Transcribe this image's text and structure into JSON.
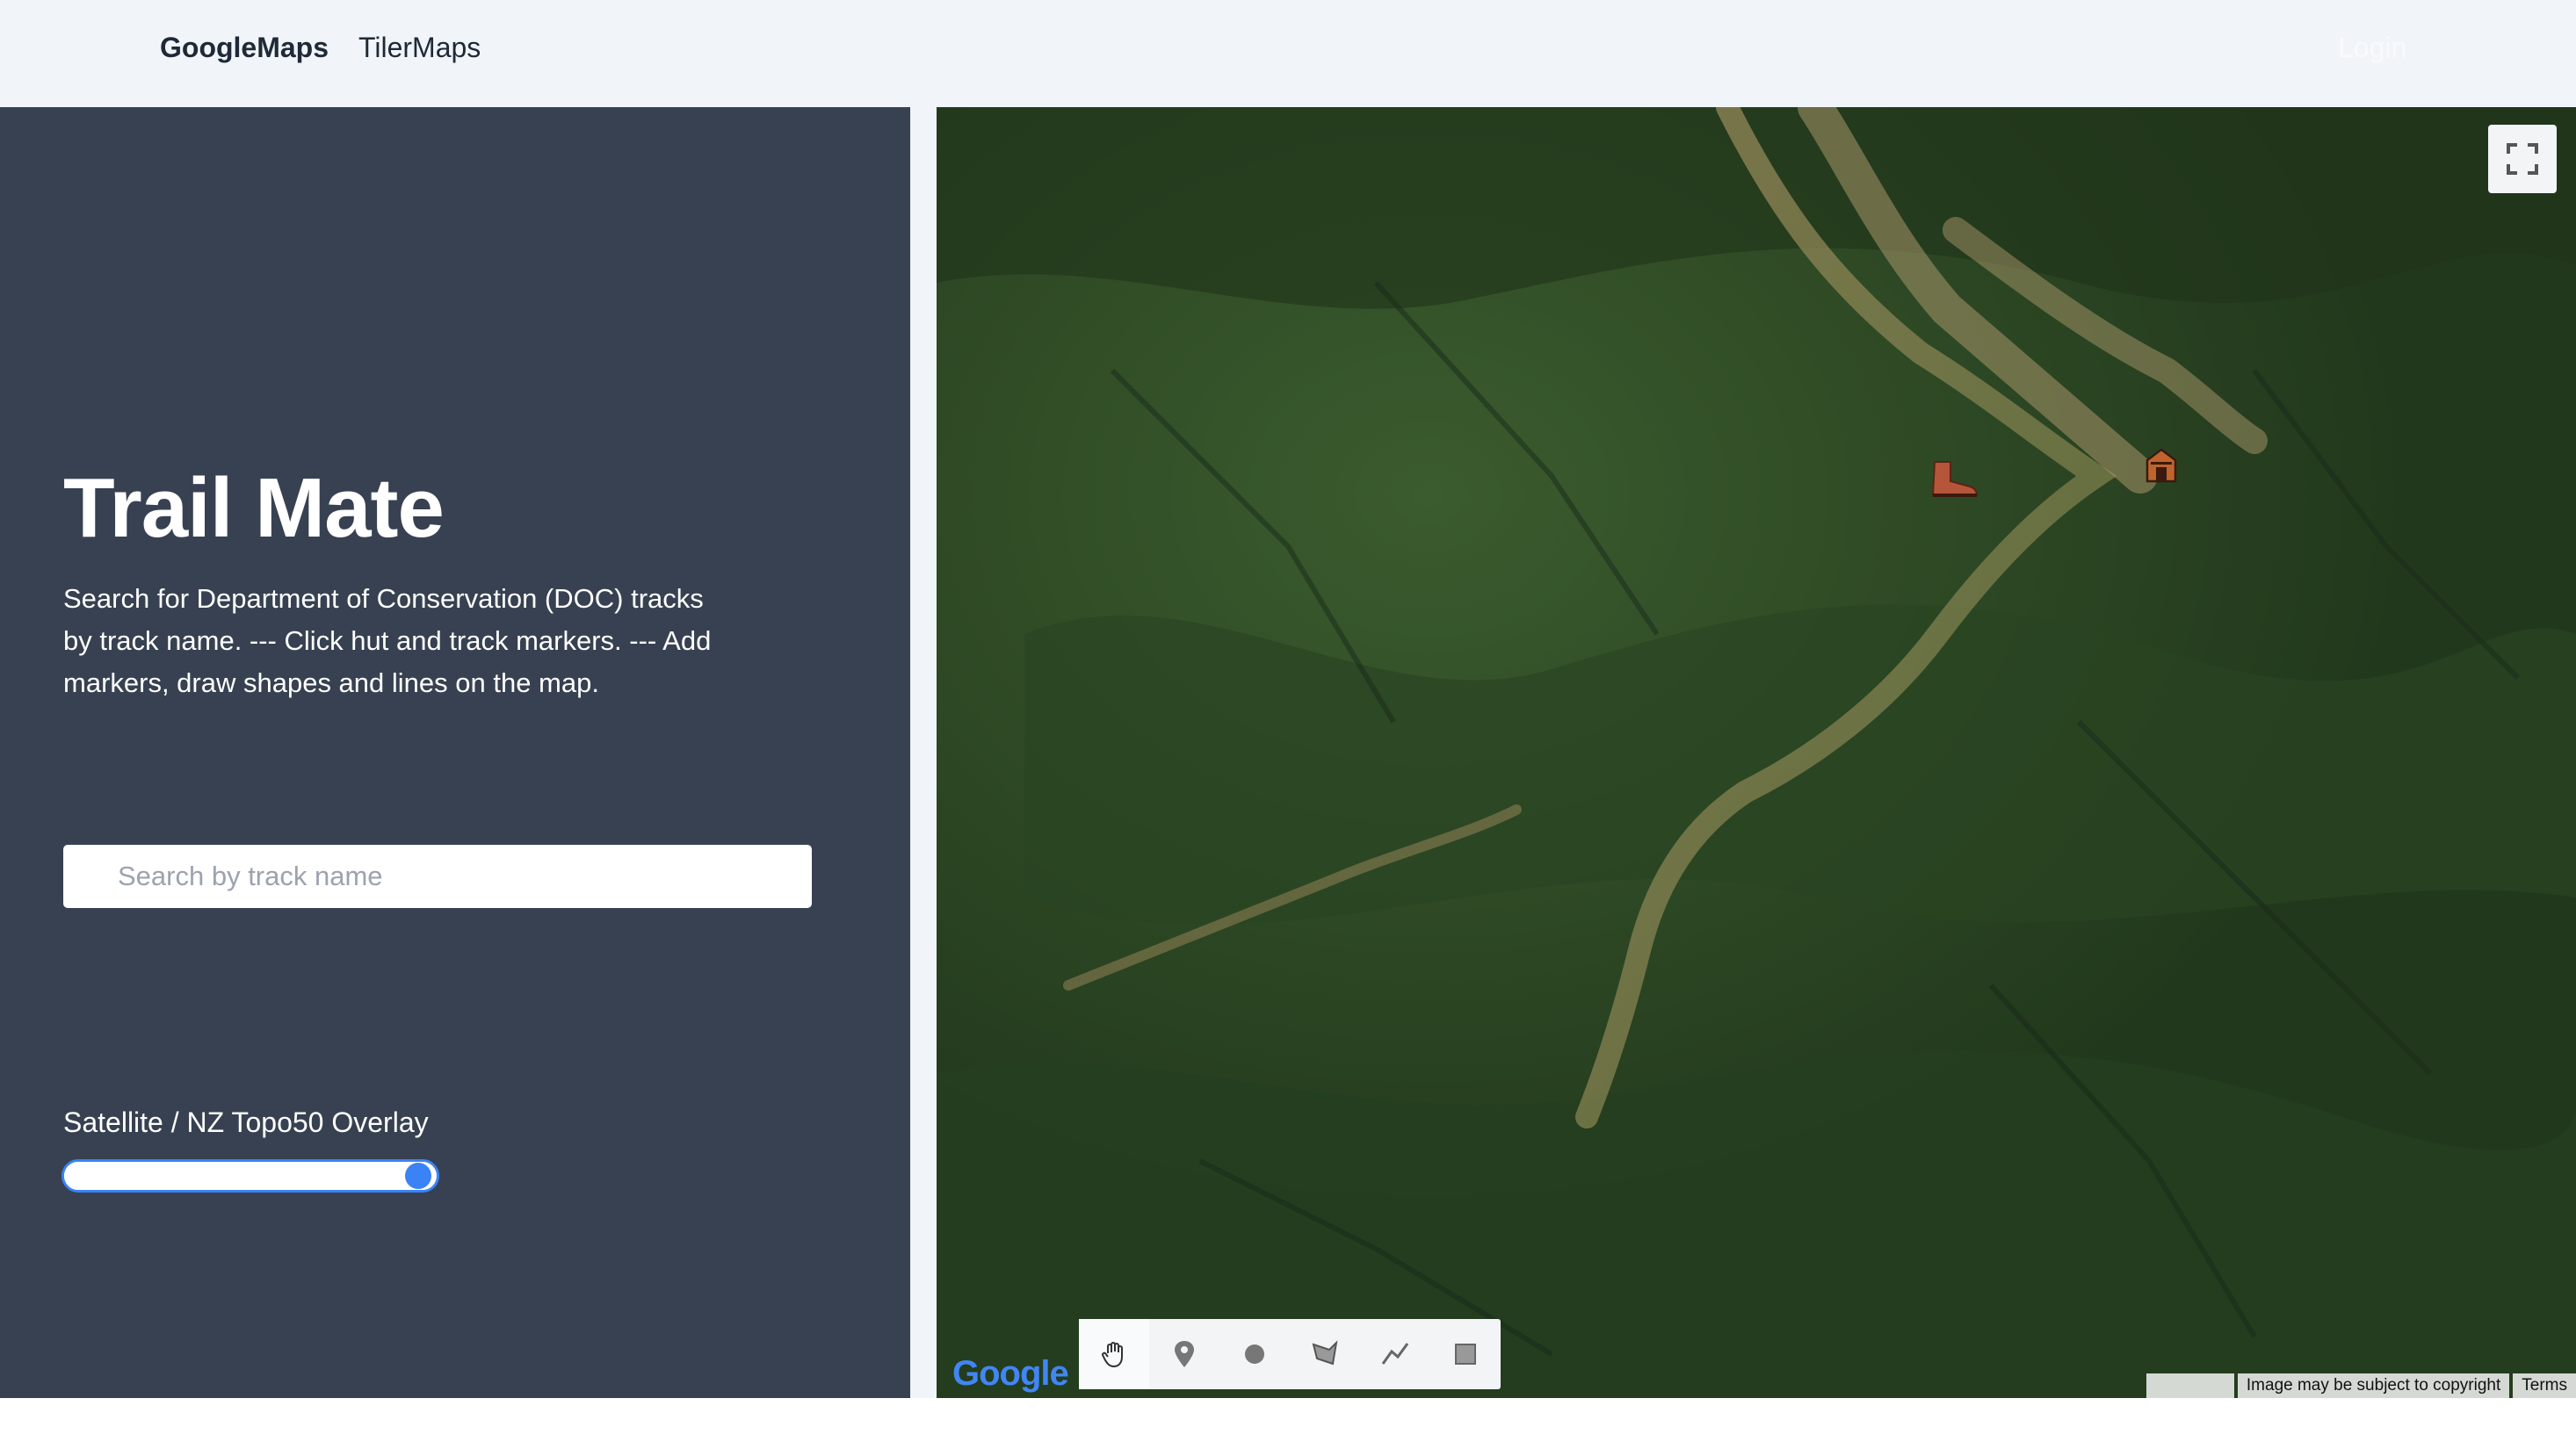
{
  "nav": {
    "brand": "GoogleMaps",
    "link": "TilerMaps",
    "login": "Login"
  },
  "sidebar": {
    "title": "Trail Mate",
    "description": "Search for Department of Conservation (DOC) tracks by track name. --- Click hut and track markers. --- Add markers, draw shapes and lines on the map.",
    "search": {
      "placeholder": "Search by track name",
      "value": ""
    },
    "overlay": {
      "label": "Satellite / NZ Topo50 Overlay",
      "level": 0.95
    }
  },
  "map": {
    "logo": "Google",
    "copyright": "Image may be subject to copyright",
    "terms": "Terms",
    "markers": [
      {
        "type": "track",
        "icon": "hiking-boot-icon"
      },
      {
        "type": "hut",
        "icon": "hut-icon"
      }
    ],
    "tools": [
      {
        "name": "pan",
        "icon": "hand-icon"
      },
      {
        "name": "marker",
        "icon": "pin-icon"
      },
      {
        "name": "circle",
        "icon": "circle-icon"
      },
      {
        "name": "polygon",
        "icon": "polygon-icon"
      },
      {
        "name": "polyline",
        "icon": "polyline-icon"
      },
      {
        "name": "rectangle",
        "icon": "rectangle-icon"
      }
    ]
  },
  "colors": {
    "sidebar_bg": "#374151",
    "header_bg": "#f1f5f9",
    "accent": "#3b82f6",
    "map_forest": "#2d4a25"
  }
}
